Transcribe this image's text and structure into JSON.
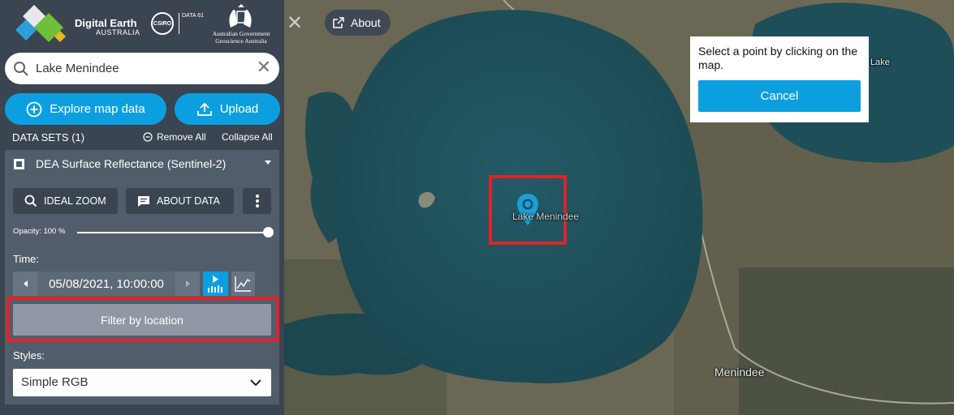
{
  "brand": {
    "name": "Digital Earth",
    "sub": "AUSTRALIA",
    "csiro": "CSIRO",
    "data61": "DATA 61",
    "govt_line1": "Australian Government",
    "govt_line2": "Geoscience Australia"
  },
  "search": {
    "value": "Lake Menindee",
    "clear_icon": "close-icon"
  },
  "actions": {
    "explore_label": "Explore map data",
    "upload_label": "Upload"
  },
  "datasets": {
    "title": "DATA SETS (1)",
    "remove_all": "Remove All",
    "collapse_all": "Collapse All",
    "items": [
      {
        "title": "DEA Surface Reflectance (Sentinel-2)",
        "ideal_zoom": "IDEAL ZOOM",
        "about_data": "ABOUT DATA",
        "opacity_label": "Opacity: 100 %",
        "opacity_value": 1.0,
        "time_label": "Time:",
        "time_value": "05/08/2021, 10:00:00",
        "filter_label": "Filter by location",
        "styles_label": "Styles:",
        "style_value": "Simple RGB"
      }
    ]
  },
  "map": {
    "close_icon": "close-icon",
    "about_label": "About",
    "lake_label": "Lake Menindee",
    "town_label": "Menindee",
    "lake2_label": "Lake",
    "highlight_color": "#e0232a"
  },
  "popup": {
    "text": "Select a point by clicking on the map.",
    "cancel_label": "Cancel"
  },
  "colors": {
    "accent": "#0c9fe0",
    "sidebar": "#3b4451",
    "card": "#525d6b",
    "lake": "#1e4f5a"
  }
}
